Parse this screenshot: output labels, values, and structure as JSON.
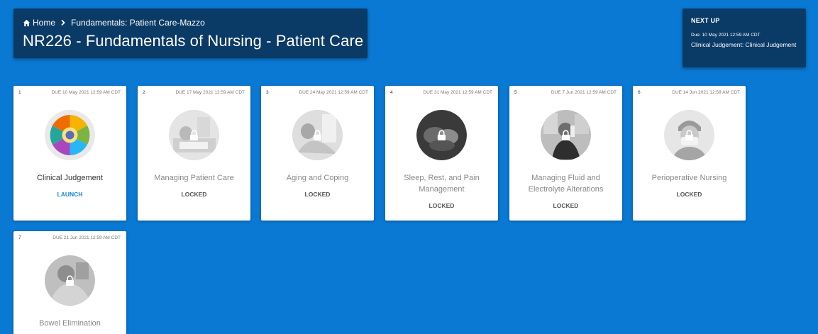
{
  "breadcrumb": {
    "home": "Home",
    "current": "Fundamentals: Patient Care-Mazzo"
  },
  "page_title": "NR226 - Fundamentals of Nursing - Patient Care",
  "next_up": {
    "label": "NEXT UP",
    "due": "Due: 10 May 2021 12:59 AM CDT",
    "name": "Clinical Judgement: Clinical Judgement"
  },
  "modules": [
    {
      "num": "1",
      "due": "DUE 10 May 2021 12:59 AM CDT",
      "title": "Clinical Judgement",
      "status": "LAUNCH",
      "locked": false,
      "thumb": "clinical-judgement-wheel-icon"
    },
    {
      "num": "2",
      "due": "DUE 17 May 2021 12:59 AM CDT",
      "title": "Managing Patient Care",
      "status": "LOCKED",
      "locked": true,
      "thumb": "patient-bed-photo"
    },
    {
      "num": "3",
      "due": "DUE 24 May 2021 12:59 AM CDT",
      "title": "Aging and Coping",
      "status": "LOCKED",
      "locked": true,
      "thumb": "elderly-patient-photo"
    },
    {
      "num": "4",
      "due": "DUE 31 May 2021 12:59 AM CDT",
      "title": "Sleep, Rest, and Pain Management",
      "status": "LOCKED",
      "locked": true,
      "thumb": "hands-photo"
    },
    {
      "num": "5",
      "due": "DUE 7 Jun 2021 12:59 AM CDT",
      "title": "Managing Fluid and Electrolyte Alterations",
      "status": "LOCKED",
      "locked": true,
      "thumb": "person-drinking-photo"
    },
    {
      "num": "6",
      "due": "DUE 14 Jun 2021 12:59 AM CDT",
      "title": "Perioperative Nursing",
      "status": "LOCKED",
      "locked": true,
      "thumb": "surgeon-photo"
    },
    {
      "num": "7",
      "due": "DUE 21 Jun 2021 12:59 AM CDT",
      "title": "Bowel Elimination",
      "status": "",
      "locked": true,
      "thumb": "patient-photo"
    }
  ],
  "colors": {
    "background": "#0a79d3",
    "header": "#0a3a66",
    "launch": "#1a86d6"
  }
}
